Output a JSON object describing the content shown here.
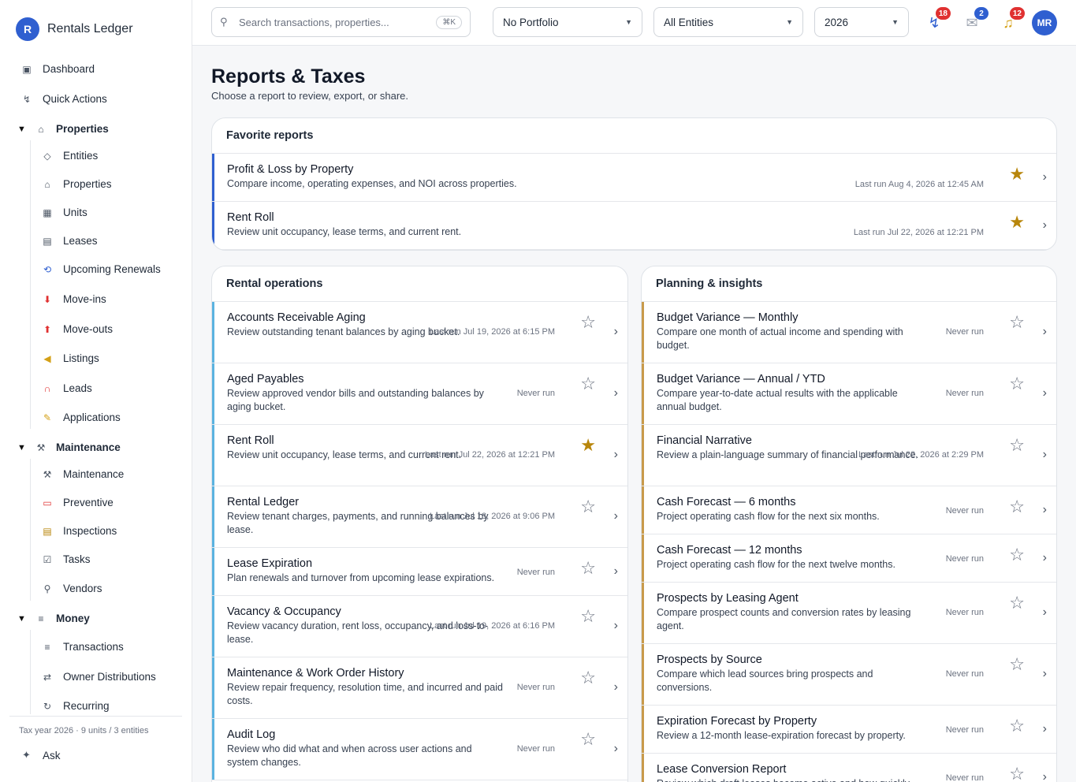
{
  "brand": {
    "initial": "R",
    "name": "Rentals Ledger"
  },
  "nav": {
    "top": [
      {
        "label": "Dashboard",
        "icon": "dashboard-icon"
      },
      {
        "label": "Quick Actions",
        "icon": "quick-actions-icon"
      }
    ],
    "groups": [
      {
        "label": "Properties",
        "items": [
          "Entities",
          "Properties",
          "Units",
          "Leases",
          "Upcoming Renewals",
          "Move-ins",
          "Move-outs",
          "Listings",
          "Leads",
          "Applications"
        ]
      },
      {
        "label": "Maintenance",
        "items": [
          "Maintenance",
          "Preventive",
          "Inspections",
          "Tasks",
          "Vendors"
        ]
      },
      {
        "label": "Money",
        "items": [
          "Transactions",
          "Owner Distributions",
          "Recurring"
        ]
      }
    ],
    "footer": "Tax year 2026 · 9 units / 3 entities",
    "ask": "Ask"
  },
  "topbar": {
    "search_placeholder": "Search transactions, properties...",
    "shortcut": "⌘K",
    "portfolio": "No Portfolio",
    "entities": "All Entities",
    "year": "2026",
    "badges": {
      "activity": "18",
      "messages": "2",
      "alerts": "12"
    },
    "avatar": "MR"
  },
  "page": {
    "title": "Reports & Taxes",
    "subtitle": "Choose a report to review, export, or share."
  },
  "favorites": {
    "title": "Favorite reports",
    "rows": [
      {
        "title": "Profit & Loss by Property",
        "desc": "Compare income, operating expenses, and NOI across properties.",
        "meta": "Last run Aug 4, 2026 at 12:45 AM",
        "fav": true
      },
      {
        "title": "Rent Roll",
        "desc": "Review unit occupancy, lease terms, and current rent.",
        "meta": "Last run Jul 22, 2026 at 12:21 PM",
        "fav": true
      }
    ]
  },
  "rental_ops": {
    "title": "Rental operations",
    "rows": [
      {
        "title": "Accounts Receivable Aging",
        "desc": "Review outstanding tenant balances by aging bucket.",
        "meta": "Last run Jul 19, 2026 at 6:15 PM",
        "fav": false
      },
      {
        "title": "Aged Payables",
        "desc": "Review approved vendor bills and outstanding balances by aging bucket.",
        "meta": "Never run",
        "fav": false
      },
      {
        "title": "Rent Roll",
        "desc": "Review unit occupancy, lease terms, and current rent.",
        "meta": "Last run Jul 22, 2026 at 12:21 PM",
        "fav": true
      },
      {
        "title": "Rental Ledger",
        "desc": "Review tenant charges, payments, and running balances by lease.",
        "meta": "Last run Jul 18, 2026 at 9:06 PM",
        "fav": false
      },
      {
        "title": "Lease Expiration",
        "desc": "Plan renewals and turnover from upcoming lease expirations.",
        "meta": "Never run",
        "fav": false
      },
      {
        "title": "Vacancy & Occupancy",
        "desc": "Review vacancy duration, rent loss, occupancy, and loss-to-lease.",
        "meta": "Last run Jul 19, 2026 at 6:16 PM",
        "fav": false
      },
      {
        "title": "Maintenance & Work Order History",
        "desc": "Review repair frequency, resolution time, and incurred and paid costs.",
        "meta": "Never run",
        "fav": false
      },
      {
        "title": "Audit Log",
        "desc": "Review who did what and when across user actions and system changes.",
        "meta": "Never run",
        "fav": false
      }
    ]
  },
  "planning": {
    "title": "Planning & insights",
    "rows": [
      {
        "title": "Budget Variance — Monthly",
        "desc": "Compare one month of actual income and spending with budget.",
        "meta": "Never run",
        "fav": false
      },
      {
        "title": "Budget Variance — Annual / YTD",
        "desc": "Compare year-to-date actual results with the applicable annual budget.",
        "meta": "Never run",
        "fav": false
      },
      {
        "title": "Financial Narrative",
        "desc": "Review a plain-language summary of financial performance.",
        "meta": "Last run Jul 22, 2026 at 2:29 PM",
        "fav": false
      },
      {
        "title": "Cash Forecast — 6 months",
        "desc": "Project operating cash flow for the next six months.",
        "meta": "Never run",
        "fav": false
      },
      {
        "title": "Cash Forecast — 12 months",
        "desc": "Project operating cash flow for the next twelve months.",
        "meta": "Never run",
        "fav": false
      },
      {
        "title": "Prospects by Leasing Agent",
        "desc": "Compare prospect counts and conversion rates by leasing agent.",
        "meta": "Never run",
        "fav": false
      },
      {
        "title": "Prospects by Source",
        "desc": "Compare which lead sources bring prospects and conversions.",
        "meta": "Never run",
        "fav": false
      },
      {
        "title": "Expiration Forecast by Property",
        "desc": "Review a 12-month lease-expiration forecast by property.",
        "meta": "Never run",
        "fav": false
      },
      {
        "title": "Lease Conversion Report",
        "desc": "Review which draft leases become active and how quickly.",
        "meta": "Never run",
        "fav": false
      }
    ]
  },
  "colors": {
    "accent": "#2f5fd0",
    "favorite_star": "#b8860b",
    "ops_bar": "#5bb3e0",
    "planning_bar": "#c89a4b"
  }
}
